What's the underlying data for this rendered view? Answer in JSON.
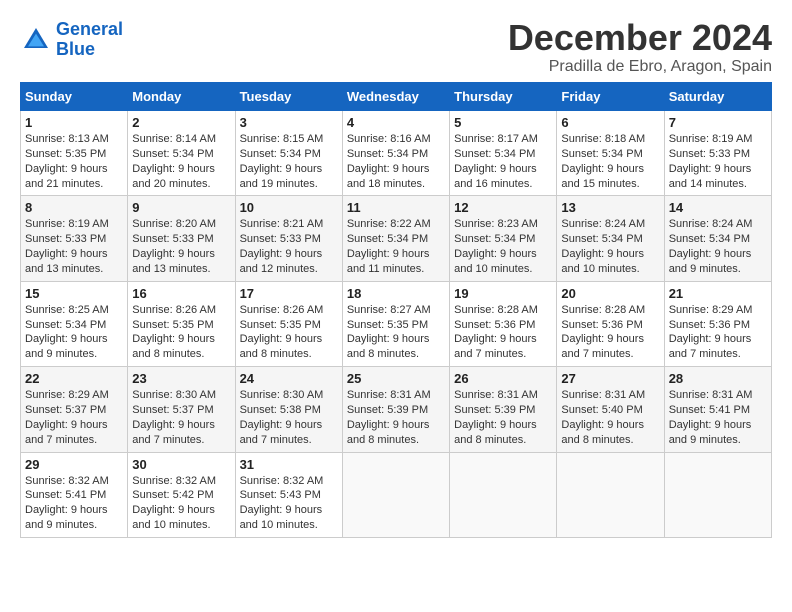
{
  "header": {
    "logo_line1": "General",
    "logo_line2": "Blue",
    "month": "December 2024",
    "location": "Pradilla de Ebro, Aragon, Spain"
  },
  "columns": [
    "Sunday",
    "Monday",
    "Tuesday",
    "Wednesday",
    "Thursday",
    "Friday",
    "Saturday"
  ],
  "weeks": [
    [
      {
        "day": "1",
        "lines": [
          "Sunrise: 8:13 AM",
          "Sunset: 5:35 PM",
          "Daylight: 9 hours",
          "and 21 minutes."
        ]
      },
      {
        "day": "2",
        "lines": [
          "Sunrise: 8:14 AM",
          "Sunset: 5:34 PM",
          "Daylight: 9 hours",
          "and 20 minutes."
        ]
      },
      {
        "day": "3",
        "lines": [
          "Sunrise: 8:15 AM",
          "Sunset: 5:34 PM",
          "Daylight: 9 hours",
          "and 19 minutes."
        ]
      },
      {
        "day": "4",
        "lines": [
          "Sunrise: 8:16 AM",
          "Sunset: 5:34 PM",
          "Daylight: 9 hours",
          "and 18 minutes."
        ]
      },
      {
        "day": "5",
        "lines": [
          "Sunrise: 8:17 AM",
          "Sunset: 5:34 PM",
          "Daylight: 9 hours",
          "and 16 minutes."
        ]
      },
      {
        "day": "6",
        "lines": [
          "Sunrise: 8:18 AM",
          "Sunset: 5:34 PM",
          "Daylight: 9 hours",
          "and 15 minutes."
        ]
      },
      {
        "day": "7",
        "lines": [
          "Sunrise: 8:19 AM",
          "Sunset: 5:33 PM",
          "Daylight: 9 hours",
          "and 14 minutes."
        ]
      }
    ],
    [
      {
        "day": "8",
        "lines": [
          "Sunrise: 8:19 AM",
          "Sunset: 5:33 PM",
          "Daylight: 9 hours",
          "and 13 minutes."
        ]
      },
      {
        "day": "9",
        "lines": [
          "Sunrise: 8:20 AM",
          "Sunset: 5:33 PM",
          "Daylight: 9 hours",
          "and 13 minutes."
        ]
      },
      {
        "day": "10",
        "lines": [
          "Sunrise: 8:21 AM",
          "Sunset: 5:33 PM",
          "Daylight: 9 hours",
          "and 12 minutes."
        ]
      },
      {
        "day": "11",
        "lines": [
          "Sunrise: 8:22 AM",
          "Sunset: 5:34 PM",
          "Daylight: 9 hours",
          "and 11 minutes."
        ]
      },
      {
        "day": "12",
        "lines": [
          "Sunrise: 8:23 AM",
          "Sunset: 5:34 PM",
          "Daylight: 9 hours",
          "and 10 minutes."
        ]
      },
      {
        "day": "13",
        "lines": [
          "Sunrise: 8:24 AM",
          "Sunset: 5:34 PM",
          "Daylight: 9 hours",
          "and 10 minutes."
        ]
      },
      {
        "day": "14",
        "lines": [
          "Sunrise: 8:24 AM",
          "Sunset: 5:34 PM",
          "Daylight: 9 hours",
          "and 9 minutes."
        ]
      }
    ],
    [
      {
        "day": "15",
        "lines": [
          "Sunrise: 8:25 AM",
          "Sunset: 5:34 PM",
          "Daylight: 9 hours",
          "and 9 minutes."
        ]
      },
      {
        "day": "16",
        "lines": [
          "Sunrise: 8:26 AM",
          "Sunset: 5:35 PM",
          "Daylight: 9 hours",
          "and 8 minutes."
        ]
      },
      {
        "day": "17",
        "lines": [
          "Sunrise: 8:26 AM",
          "Sunset: 5:35 PM",
          "Daylight: 9 hours",
          "and 8 minutes."
        ]
      },
      {
        "day": "18",
        "lines": [
          "Sunrise: 8:27 AM",
          "Sunset: 5:35 PM",
          "Daylight: 9 hours",
          "and 8 minutes."
        ]
      },
      {
        "day": "19",
        "lines": [
          "Sunrise: 8:28 AM",
          "Sunset: 5:36 PM",
          "Daylight: 9 hours",
          "and 7 minutes."
        ]
      },
      {
        "day": "20",
        "lines": [
          "Sunrise: 8:28 AM",
          "Sunset: 5:36 PM",
          "Daylight: 9 hours",
          "and 7 minutes."
        ]
      },
      {
        "day": "21",
        "lines": [
          "Sunrise: 8:29 AM",
          "Sunset: 5:36 PM",
          "Daylight: 9 hours",
          "and 7 minutes."
        ]
      }
    ],
    [
      {
        "day": "22",
        "lines": [
          "Sunrise: 8:29 AM",
          "Sunset: 5:37 PM",
          "Daylight: 9 hours",
          "and 7 minutes."
        ]
      },
      {
        "day": "23",
        "lines": [
          "Sunrise: 8:30 AM",
          "Sunset: 5:37 PM",
          "Daylight: 9 hours",
          "and 7 minutes."
        ]
      },
      {
        "day": "24",
        "lines": [
          "Sunrise: 8:30 AM",
          "Sunset: 5:38 PM",
          "Daylight: 9 hours",
          "and 7 minutes."
        ]
      },
      {
        "day": "25",
        "lines": [
          "Sunrise: 8:31 AM",
          "Sunset: 5:39 PM",
          "Daylight: 9 hours",
          "and 8 minutes."
        ]
      },
      {
        "day": "26",
        "lines": [
          "Sunrise: 8:31 AM",
          "Sunset: 5:39 PM",
          "Daylight: 9 hours",
          "and 8 minutes."
        ]
      },
      {
        "day": "27",
        "lines": [
          "Sunrise: 8:31 AM",
          "Sunset: 5:40 PM",
          "Daylight: 9 hours",
          "and 8 minutes."
        ]
      },
      {
        "day": "28",
        "lines": [
          "Sunrise: 8:31 AM",
          "Sunset: 5:41 PM",
          "Daylight: 9 hours",
          "and 9 minutes."
        ]
      }
    ],
    [
      {
        "day": "29",
        "lines": [
          "Sunrise: 8:32 AM",
          "Sunset: 5:41 PM",
          "Daylight: 9 hours",
          "and 9 minutes."
        ]
      },
      {
        "day": "30",
        "lines": [
          "Sunrise: 8:32 AM",
          "Sunset: 5:42 PM",
          "Daylight: 9 hours",
          "and 10 minutes."
        ]
      },
      {
        "day": "31",
        "lines": [
          "Sunrise: 8:32 AM",
          "Sunset: 5:43 PM",
          "Daylight: 9 hours",
          "and 10 minutes."
        ]
      },
      null,
      null,
      null,
      null
    ]
  ]
}
